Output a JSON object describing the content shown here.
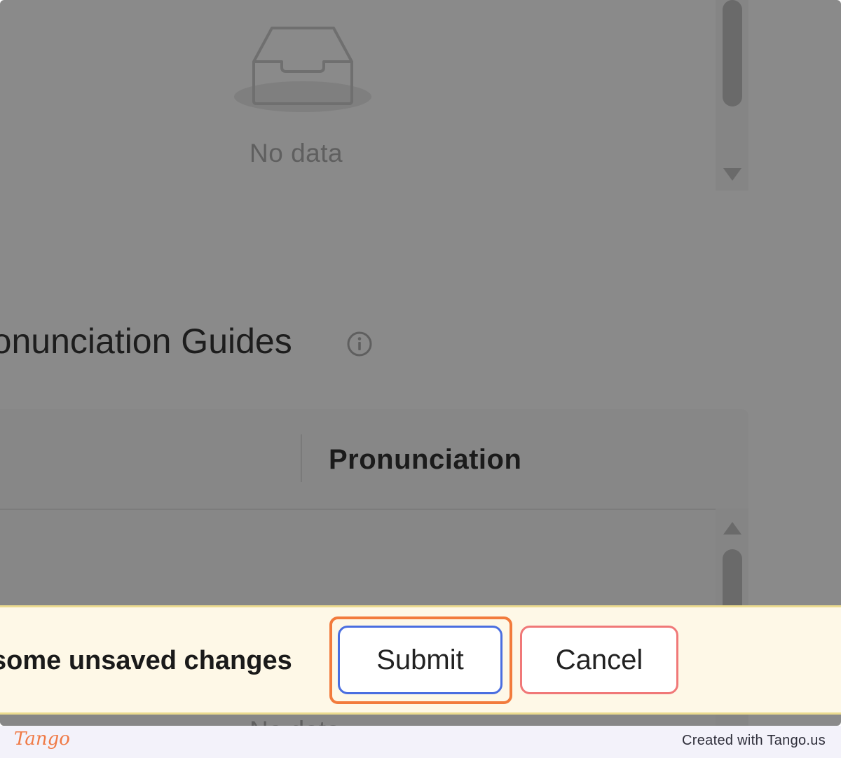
{
  "empty_state": {
    "icon": "inbox-icon",
    "text": "No data"
  },
  "section": {
    "title": "ronunciation Guides",
    "info_icon": "info-icon"
  },
  "table": {
    "columns": [
      "",
      "Pronunciation"
    ],
    "body_empty_text": "No data"
  },
  "unsaved_bar": {
    "message": "some unsaved changes",
    "submit_label": "Submit",
    "cancel_label": "Cancel"
  },
  "footer": {
    "logo_text": "Tango",
    "credit": "Created with Tango.us"
  },
  "colors": {
    "overlay": "#8a8a8a",
    "bar_background": "#fef8e7",
    "submit_border": "#4a6ee0",
    "cancel_border": "#f07878",
    "highlight": "#f27b3c",
    "brand": "#f07a45"
  }
}
